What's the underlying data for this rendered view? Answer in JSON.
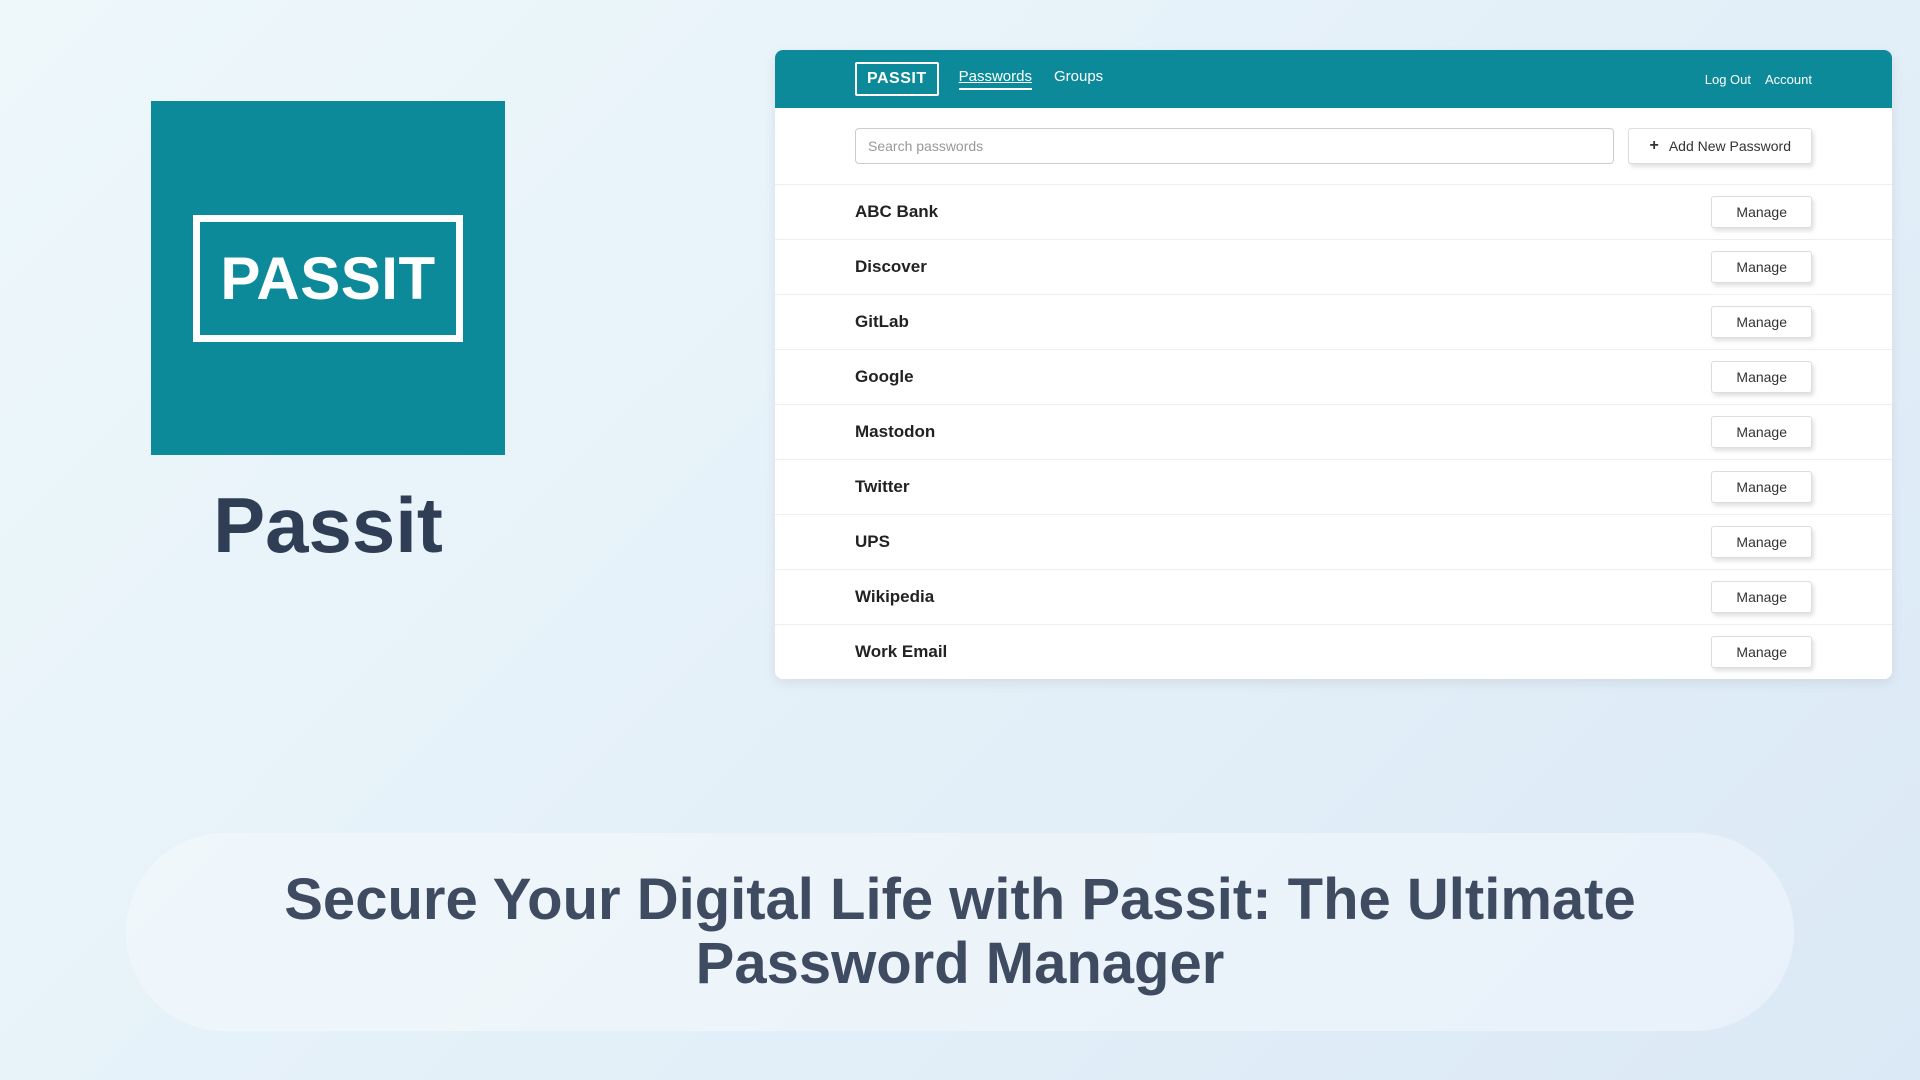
{
  "branding": {
    "logo_text": "PASSIT",
    "title": "Passit"
  },
  "app": {
    "logo_text": "PASSIT",
    "nav": {
      "passwords": "Passwords",
      "groups": "Groups"
    },
    "header_links": {
      "logout": "Log Out",
      "account": "Account"
    },
    "search": {
      "placeholder": "Search passwords"
    },
    "add_button": "Add New Password",
    "manage_label": "Manage",
    "passwords": [
      {
        "name": "ABC Bank"
      },
      {
        "name": "Discover"
      },
      {
        "name": "GitLab"
      },
      {
        "name": "Google"
      },
      {
        "name": "Mastodon"
      },
      {
        "name": "Twitter"
      },
      {
        "name": "UPS"
      },
      {
        "name": "Wikipedia"
      },
      {
        "name": "Work Email"
      }
    ]
  },
  "tagline": "Secure Your Digital Life with Passit: The Ultimate Password Manager"
}
